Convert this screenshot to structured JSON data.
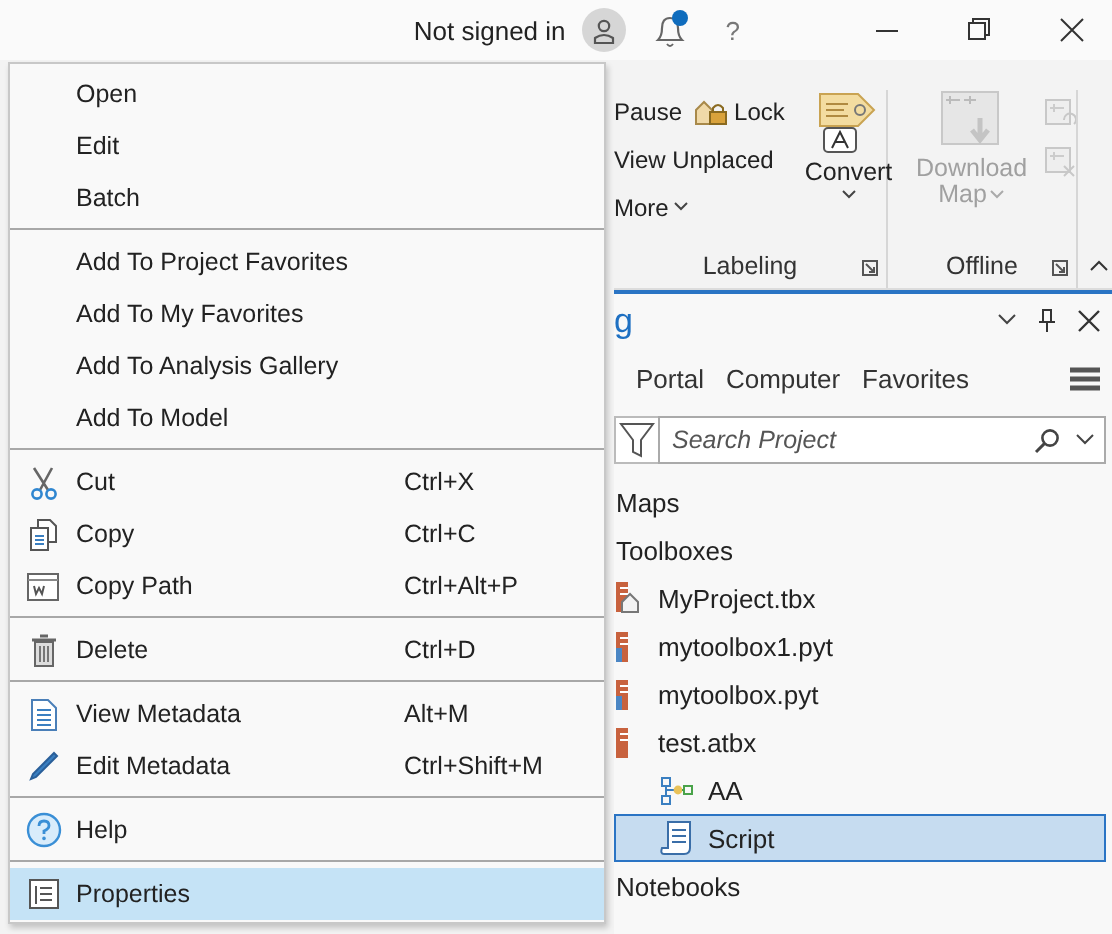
{
  "title_bar": {
    "account": "Not signed in",
    "notification_badge": true,
    "help": "?"
  },
  "ribbon": {
    "labeling": {
      "pause": "Pause",
      "lock": "Lock",
      "view_unplaced": "View Unplaced",
      "more": "More",
      "convert": "Convert",
      "group_label": "Labeling"
    },
    "offline": {
      "download_map": "Download",
      "download_map_line_2": "Map",
      "disabled": true,
      "group_label": "Offline"
    }
  },
  "catalog_pane": {
    "title": "g",
    "tabs": [
      {
        "label": "Portal",
        "selected": false
      },
      {
        "label": "Computer",
        "selected": false
      },
      {
        "label": "Favorites",
        "selected": false
      }
    ],
    "search": {
      "placeholder": "Search Project"
    },
    "tree": [
      {
        "label": "Maps",
        "selected": false
      },
      {
        "label": "Toolboxes",
        "selected": false,
        "children": [
          {
            "label": "MyProject.tbx",
            "kind": "home-toolbox",
            "selected": false
          },
          {
            "label": "mytoolbox1.pyt",
            "kind": "python-toolbox",
            "selected": false
          },
          {
            "label": "mytoolbox.pyt",
            "kind": "python-toolbox",
            "selected": false
          },
          {
            "label": "test.atbx",
            "kind": "toolbox",
            "selected": false,
            "children": [
              {
                "label": "AA",
                "kind": "model",
                "selected": false
              },
              {
                "label": "Script",
                "kind": "script",
                "selected": true
              }
            ]
          }
        ]
      },
      {
        "label": "Notebooks",
        "selected": false
      }
    ]
  },
  "context_menu": {
    "groups": [
      [
        {
          "label": "Open",
          "selected": false
        },
        {
          "label": "Edit",
          "selected": false
        },
        {
          "label": "Batch",
          "selected": false
        }
      ],
      [
        {
          "label": "Add To Project Favorites",
          "selected": false
        },
        {
          "label": "Add To My Favorites",
          "selected": false
        },
        {
          "label": "Add To Analysis Gallery",
          "selected": false
        },
        {
          "label": "Add To Model",
          "selected": false
        }
      ],
      [
        {
          "label": "Cut",
          "shortcut": "Ctrl+X",
          "selected": false
        },
        {
          "label": "Copy",
          "shortcut": "Ctrl+C",
          "selected": false
        },
        {
          "label": "Copy Path",
          "shortcut": "Ctrl+Alt+P",
          "selected": false
        }
      ],
      [
        {
          "label": "Delete",
          "shortcut": "Ctrl+D",
          "selected": false
        }
      ],
      [
        {
          "label": "View Metadata",
          "shortcut": "Alt+M",
          "selected": false
        },
        {
          "label": "Edit Metadata",
          "shortcut": "Ctrl+Shift+M",
          "selected": false
        }
      ],
      [
        {
          "label": "Help",
          "selected": false
        }
      ],
      [
        {
          "label": "Properties",
          "selected": true
        }
      ]
    ]
  }
}
